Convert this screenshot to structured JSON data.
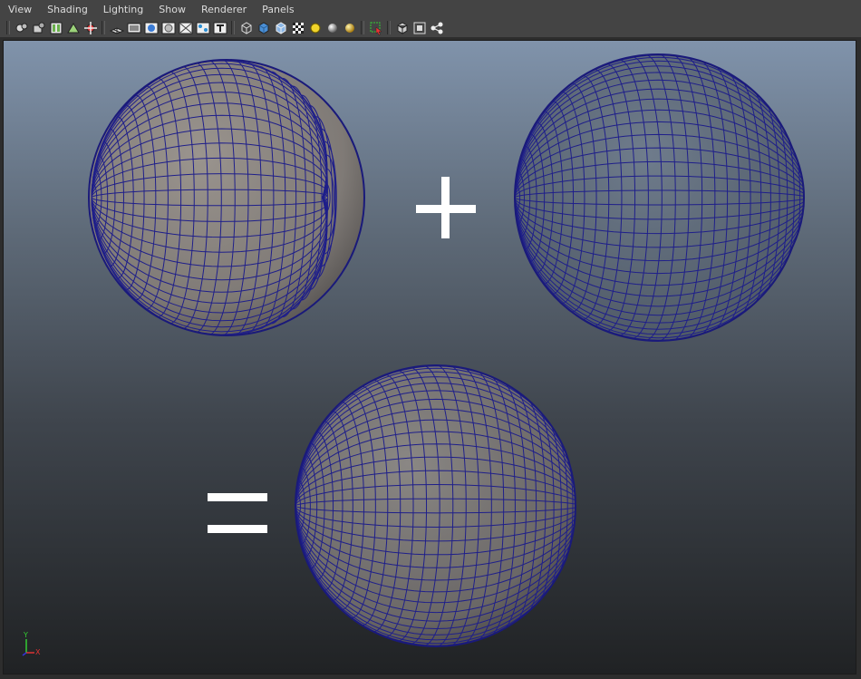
{
  "menubar": {
    "items": [
      "View",
      "Shading",
      "Lighting",
      "Show",
      "Renderer",
      "Panels"
    ]
  },
  "toolbar": {
    "groups": [
      [
        "camera-attributes-icon",
        "bookmark-icon",
        "image-plane-icon",
        "pan-zoom-icon",
        "two-d-pan-icon"
      ],
      [
        "grid-icon",
        "film-gate-icon",
        "resolution-gate-icon",
        "gate-mask-icon",
        "field-chart-icon",
        "safe-action-icon",
        "safe-title-icon"
      ],
      [
        "wireframe-icon",
        "smooth-shade-icon",
        "wireframe-on-shaded-icon",
        "textured-icon",
        "default-light-icon",
        "shadows-icon",
        "high-quality-icon"
      ],
      [
        "select-camera-icon"
      ],
      [
        "isolate-select-icon",
        "xray-icon",
        "node-network-icon"
      ]
    ]
  },
  "viewport": {
    "symbols": {
      "plus": "+",
      "equals": "="
    },
    "axis": {
      "y": "Y",
      "x": "X"
    }
  },
  "colors": {
    "wire": "#1f1f8a",
    "surface": "#8a8580",
    "gradient_top": "#8093ab",
    "gradient_bottom": "#202224"
  }
}
